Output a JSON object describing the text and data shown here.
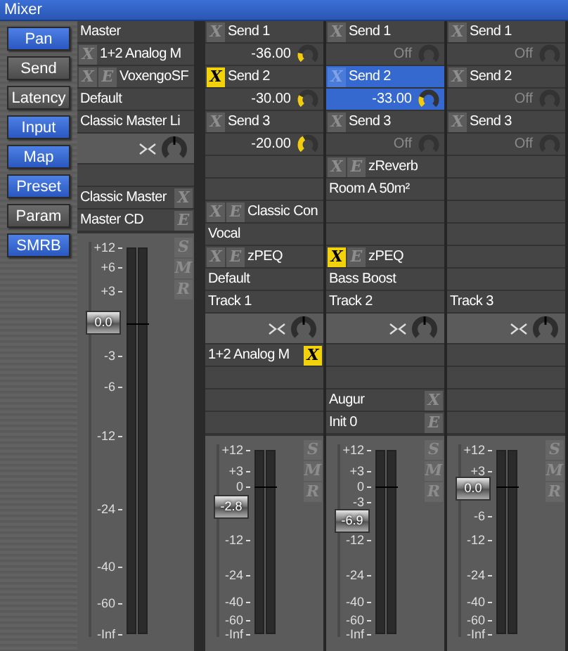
{
  "window": {
    "title": "Mixer"
  },
  "sidebar": {
    "buttons": [
      {
        "label": "Pan",
        "on": true
      },
      {
        "label": "Send",
        "on": false
      },
      {
        "label": "Latency",
        "on": false
      },
      {
        "label": "Input",
        "on": true
      },
      {
        "label": "Map",
        "on": true
      },
      {
        "label": "Preset",
        "on": true
      },
      {
        "label": "Param",
        "on": false
      },
      {
        "label": "SMRB",
        "on": true
      }
    ]
  },
  "strips": [
    {
      "rows": [
        {
          "kind": "name",
          "text": "Master"
        },
        {
          "kind": "plugin",
          "text": "1+2 Analog M",
          "buttons_left": [
            {
              "label": "X",
              "on": false
            }
          ]
        },
        {
          "kind": "plugin",
          "text": "VoxengoSF",
          "buttons_left": [
            {
              "label": "X",
              "on": false
            },
            {
              "label": "E",
              "on": false
            }
          ]
        },
        {
          "kind": "label",
          "text": "Default"
        },
        {
          "kind": "label",
          "text": "Classic Master Li"
        },
        {
          "kind": "pan"
        },
        {
          "kind": "blank"
        },
        {
          "kind": "plugin",
          "text": "Classic Master",
          "buttons_right": [
            {
              "label": "X",
              "on": false
            }
          ]
        },
        {
          "kind": "plugin",
          "text": "Master CD",
          "buttons_right": [
            {
              "label": "E",
              "on": false
            }
          ]
        }
      ],
      "fader": {
        "value": "0.0",
        "level": 0.804,
        "ticks": [
          "+12",
          "+6",
          "+3",
          "-3",
          "-6",
          "-12",
          "-24",
          "-40",
          "-60",
          "-Inf"
        ],
        "buttons": [
          {
            "label": "S",
            "on": false
          },
          {
            "label": "M",
            "on": false
          },
          {
            "label": "R",
            "on": false
          }
        ]
      }
    },
    {
      "rows": [
        {
          "kind": "send",
          "label": "Send 1",
          "bypass": {
            "label": "X",
            "on": false
          },
          "value": "-36.00",
          "selected": false
        },
        {
          "kind": "send",
          "label": "Send 2",
          "bypass": {
            "label": "X",
            "on": true
          },
          "value": "-30.00",
          "selected": false
        },
        {
          "kind": "send",
          "label": "Send 3",
          "bypass": {
            "label": "X",
            "on": false
          },
          "value": "-20.00",
          "selected": false
        },
        {
          "kind": "blank"
        },
        {
          "kind": "blank"
        },
        {
          "kind": "plugin",
          "text": "Classic Con",
          "buttons_left": [
            {
              "label": "X",
              "on": false
            },
            {
              "label": "E",
              "on": false
            }
          ]
        },
        {
          "kind": "label",
          "text": "Vocal"
        },
        {
          "kind": "plugin",
          "text": "zPEQ",
          "buttons_left": [
            {
              "label": "X",
              "on": false
            },
            {
              "label": "E",
              "on": false
            }
          ]
        },
        {
          "kind": "label",
          "text": "Default"
        },
        {
          "kind": "name",
          "text": "Track 1"
        },
        {
          "kind": "pan"
        },
        {
          "kind": "plugin",
          "text": "1+2 Analog M",
          "buttons_right": [
            {
              "label": "X",
              "on": true
            }
          ]
        },
        {
          "kind": "blank"
        },
        {
          "kind": "blank"
        },
        {
          "kind": "blank"
        }
      ],
      "fader": {
        "value": "-2.8",
        "level": 0.69,
        "ticks": [
          "+12",
          "+3",
          "0",
          "-12",
          "-24",
          "-40",
          "-60",
          "-Inf"
        ],
        "buttons": [
          {
            "label": "S",
            "on": false
          },
          {
            "label": "M",
            "on": false
          },
          {
            "label": "R",
            "on": false
          }
        ]
      }
    },
    {
      "rows": [
        {
          "kind": "send",
          "label": "Send 1",
          "bypass": {
            "label": "X",
            "on": false
          },
          "value": "Off",
          "selected": false
        },
        {
          "kind": "send",
          "label": "Send 2",
          "bypass": {
            "label": "X",
            "on": false
          },
          "value": "-33.00",
          "selected": true
        },
        {
          "kind": "send",
          "label": "Send 3",
          "bypass": {
            "label": "X",
            "on": false
          },
          "value": "Off",
          "selected": false
        },
        {
          "kind": "plugin",
          "text": "zReverb",
          "buttons_left": [
            {
              "label": "X",
              "on": false
            },
            {
              "label": "E",
              "on": false
            }
          ]
        },
        {
          "kind": "label",
          "text": "Room A 50m²"
        },
        {
          "kind": "blank"
        },
        {
          "kind": "blank"
        },
        {
          "kind": "plugin",
          "text": "zPEQ",
          "buttons_left": [
            {
              "label": "X",
              "on": true
            },
            {
              "label": "E",
              "on": false
            }
          ]
        },
        {
          "kind": "label",
          "text": "Bass Boost"
        },
        {
          "kind": "name",
          "text": "Track 2"
        },
        {
          "kind": "pan"
        },
        {
          "kind": "blank"
        },
        {
          "kind": "blank"
        },
        {
          "kind": "plugin",
          "text": "Augur",
          "buttons_right": [
            {
              "label": "X",
              "on": false
            }
          ]
        },
        {
          "kind": "plugin",
          "text": "Init 0",
          "buttons_right": [
            {
              "label": "E",
              "on": false
            }
          ]
        }
      ],
      "fader": {
        "value": "-6.9",
        "level": 0.615,
        "ticks": [
          "+12",
          "+3",
          "0",
          "-3",
          "-12",
          "-24",
          "-40",
          "-60",
          "-Inf"
        ],
        "buttons": [
          {
            "label": "S",
            "on": false
          },
          {
            "label": "M",
            "on": false
          },
          {
            "label": "R",
            "on": false
          }
        ]
      }
    },
    {
      "rows": [
        {
          "kind": "send",
          "label": "Send 1",
          "bypass": {
            "label": "X",
            "on": false
          },
          "value": "Off",
          "selected": false
        },
        {
          "kind": "send",
          "label": "Send 2",
          "bypass": {
            "label": "X",
            "on": false
          },
          "value": "Off",
          "selected": false
        },
        {
          "kind": "send",
          "label": "Send 3",
          "bypass": {
            "label": "X",
            "on": false
          },
          "value": "Off",
          "selected": false
        },
        {
          "kind": "blank"
        },
        {
          "kind": "blank"
        },
        {
          "kind": "blank"
        },
        {
          "kind": "blank"
        },
        {
          "kind": "blank"
        },
        {
          "kind": "blank"
        },
        {
          "kind": "name",
          "text": "Track 3"
        },
        {
          "kind": "pan"
        },
        {
          "kind": "blank"
        },
        {
          "kind": "blank"
        },
        {
          "kind": "blank"
        },
        {
          "kind": "blank"
        }
      ],
      "fader": {
        "value": "0.0",
        "level": 0.79,
        "ticks": [
          "+12",
          "+3",
          "-6",
          "-12",
          "-24",
          "-40",
          "-60",
          "-Inf"
        ],
        "buttons": [
          {
            "label": "S",
            "on": false
          },
          {
            "label": "M",
            "on": false
          },
          {
            "label": "R",
            "on": false
          }
        ]
      }
    }
  ]
}
